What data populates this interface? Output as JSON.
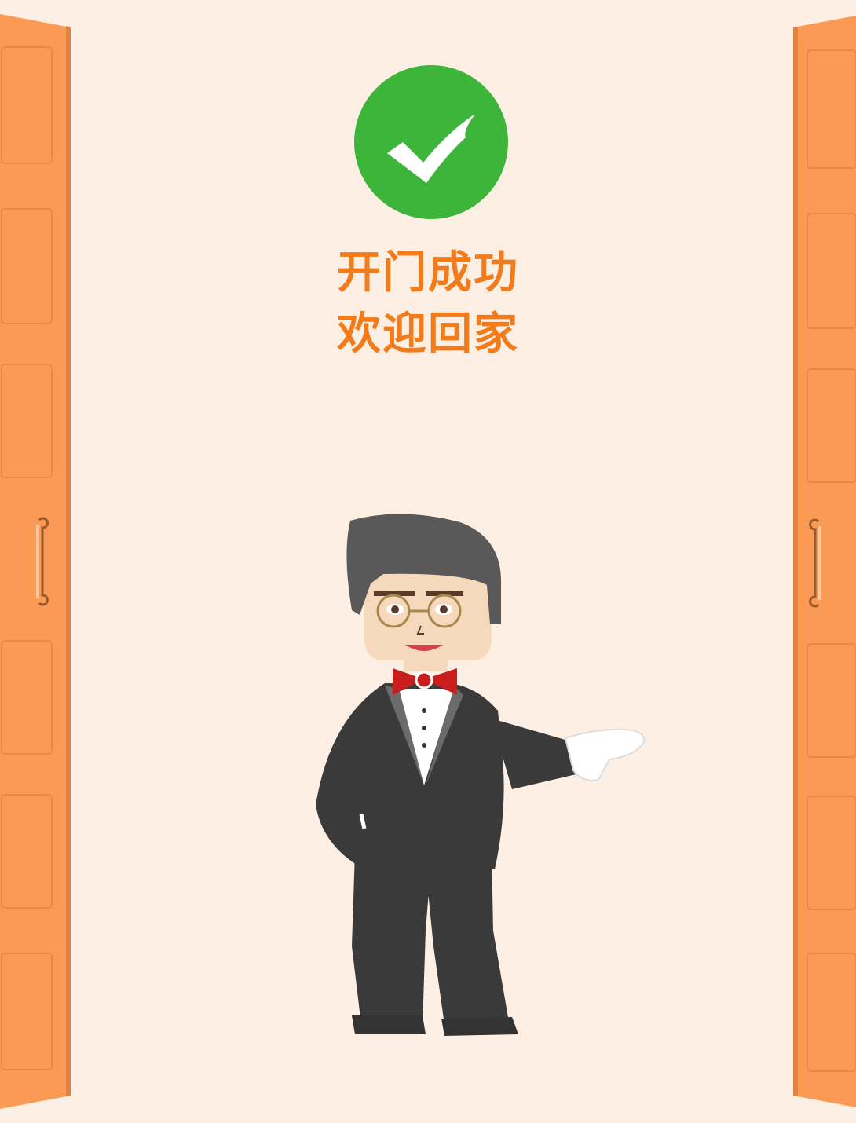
{
  "status": {
    "icon": "check-circle-icon",
    "color": "#3db53a",
    "line1": "开门成功",
    "line2": "欢迎回家"
  },
  "illustration": {
    "subject": "butler-icon",
    "doors": "door-icon"
  },
  "colors": {
    "background": "#fdefe3",
    "door": "#fb9a55",
    "title": "#f27c1c"
  }
}
